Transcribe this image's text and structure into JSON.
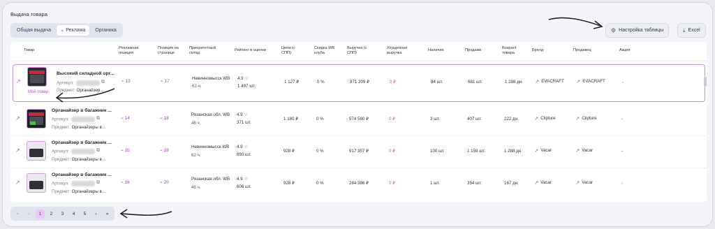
{
  "page": {
    "title": "Выдача товара"
  },
  "tabs": [
    {
      "label": "Общая выдача",
      "icon": ""
    },
    {
      "label": "Реклама",
      "icon": "link-icon"
    },
    {
      "label": "Органика",
      "icon": ""
    }
  ],
  "toolbar": {
    "settings_label": "Настройка таблицы",
    "excel_label": "Excel"
  },
  "columns": {
    "product": "Товар",
    "ad_pos": "Рекламная позиция",
    "page_pos": "Позиция на странице",
    "warehouse": "Приоритетный склад",
    "rating": "Рейтинг и оценки",
    "price": "Цена (с СПП)",
    "discount": "Скидка WB клуба",
    "revenue": "Выручка (с СПП)",
    "lost": "Упущенная выручка",
    "stock": "Наличие",
    "sales": "Продажи",
    "age": "Возраст товара",
    "brand": "Бренд",
    "seller": "Продавец",
    "promo": "Акция"
  },
  "labels": {
    "article": "Артикул:",
    "subject": "Предмет:",
    "my_product": "Мой товар"
  },
  "rows": [
    {
      "name": "Высокий складной орг...",
      "subject": "Органайзер...",
      "ad_pos": "13",
      "page_pos": "17",
      "warehouse": "Невинномысск WB",
      "hours": "62 ч.",
      "rating": "4.9",
      "reviews": "1 497 шт.",
      "price": "1 127 ₽",
      "discount": "0 %",
      "revenue": "871 209 ₽",
      "lost": "0 ₽",
      "stock": "84 шт.",
      "sales": "681 шт.",
      "age": "1 288 дн.",
      "brand": "EVACRAFT",
      "seller": "EVACRAFT",
      "promo": "-"
    },
    {
      "name": "Органайзер в багажник ...",
      "subject": "Органайзеры в...",
      "ad_pos": "14",
      "page_pos": "18",
      "warehouse": "Рязанская обл. WB",
      "hours": "46 ч.",
      "rating": "4.9",
      "reviews": "371 шт.",
      "price": "1 180 ₽",
      "discount": "0 %",
      "revenue": "574 580 ₽",
      "lost": "0 ₽",
      "stock": "3 шт.",
      "sales": "407 шт.",
      "age": "222 дн.",
      "brand": "Clipture",
      "seller": "Clipture",
      "promo": "-"
    },
    {
      "name": "Органайзер в багажник ...",
      "subject": "Органайзеры в...",
      "ad_pos": "15",
      "page_pos": "19",
      "warehouse": "Невинномысск WB",
      "hours": "62 ч.",
      "rating": "4.9",
      "reviews": "893 шт.",
      "price": "928 ₽",
      "discount": "0 %",
      "revenue": "917 357 ₽",
      "lost": "0 ₽",
      "stock": "100 шт.",
      "sales": "1 159 шт.",
      "age": "1 288 дн.",
      "brand": "Vacar",
      "seller": "Vacar",
      "promo": "-"
    },
    {
      "name": "Органайзер в багажник ...",
      "subject": "Органайзеры в...",
      "ad_pos": "16",
      "page_pos": "20",
      "warehouse": "Рязанская обл. WB",
      "hours": "46 ч.",
      "rating": "4.9",
      "reviews": "606 шт.",
      "price": "928 ₽",
      "discount": "0 %",
      "revenue": "284 386 ₽",
      "lost": "0 ₽",
      "stock": "1 шт.",
      "sales": "354 шт.",
      "age": "167 дн.",
      "brand": "Vacar",
      "seller": "Vacar",
      "promo": "-"
    }
  ],
  "pagination": {
    "first": "«",
    "prev": "‹",
    "pages": [
      "1",
      "2",
      "3",
      "4",
      "5"
    ],
    "next": "›",
    "last": "»",
    "current": "1"
  },
  "colors": {
    "accent": "#b04fc4",
    "highlight_border": "#cf8de0",
    "lost_revenue": "#e05252",
    "active_page_bg": "#ecc7f5"
  }
}
